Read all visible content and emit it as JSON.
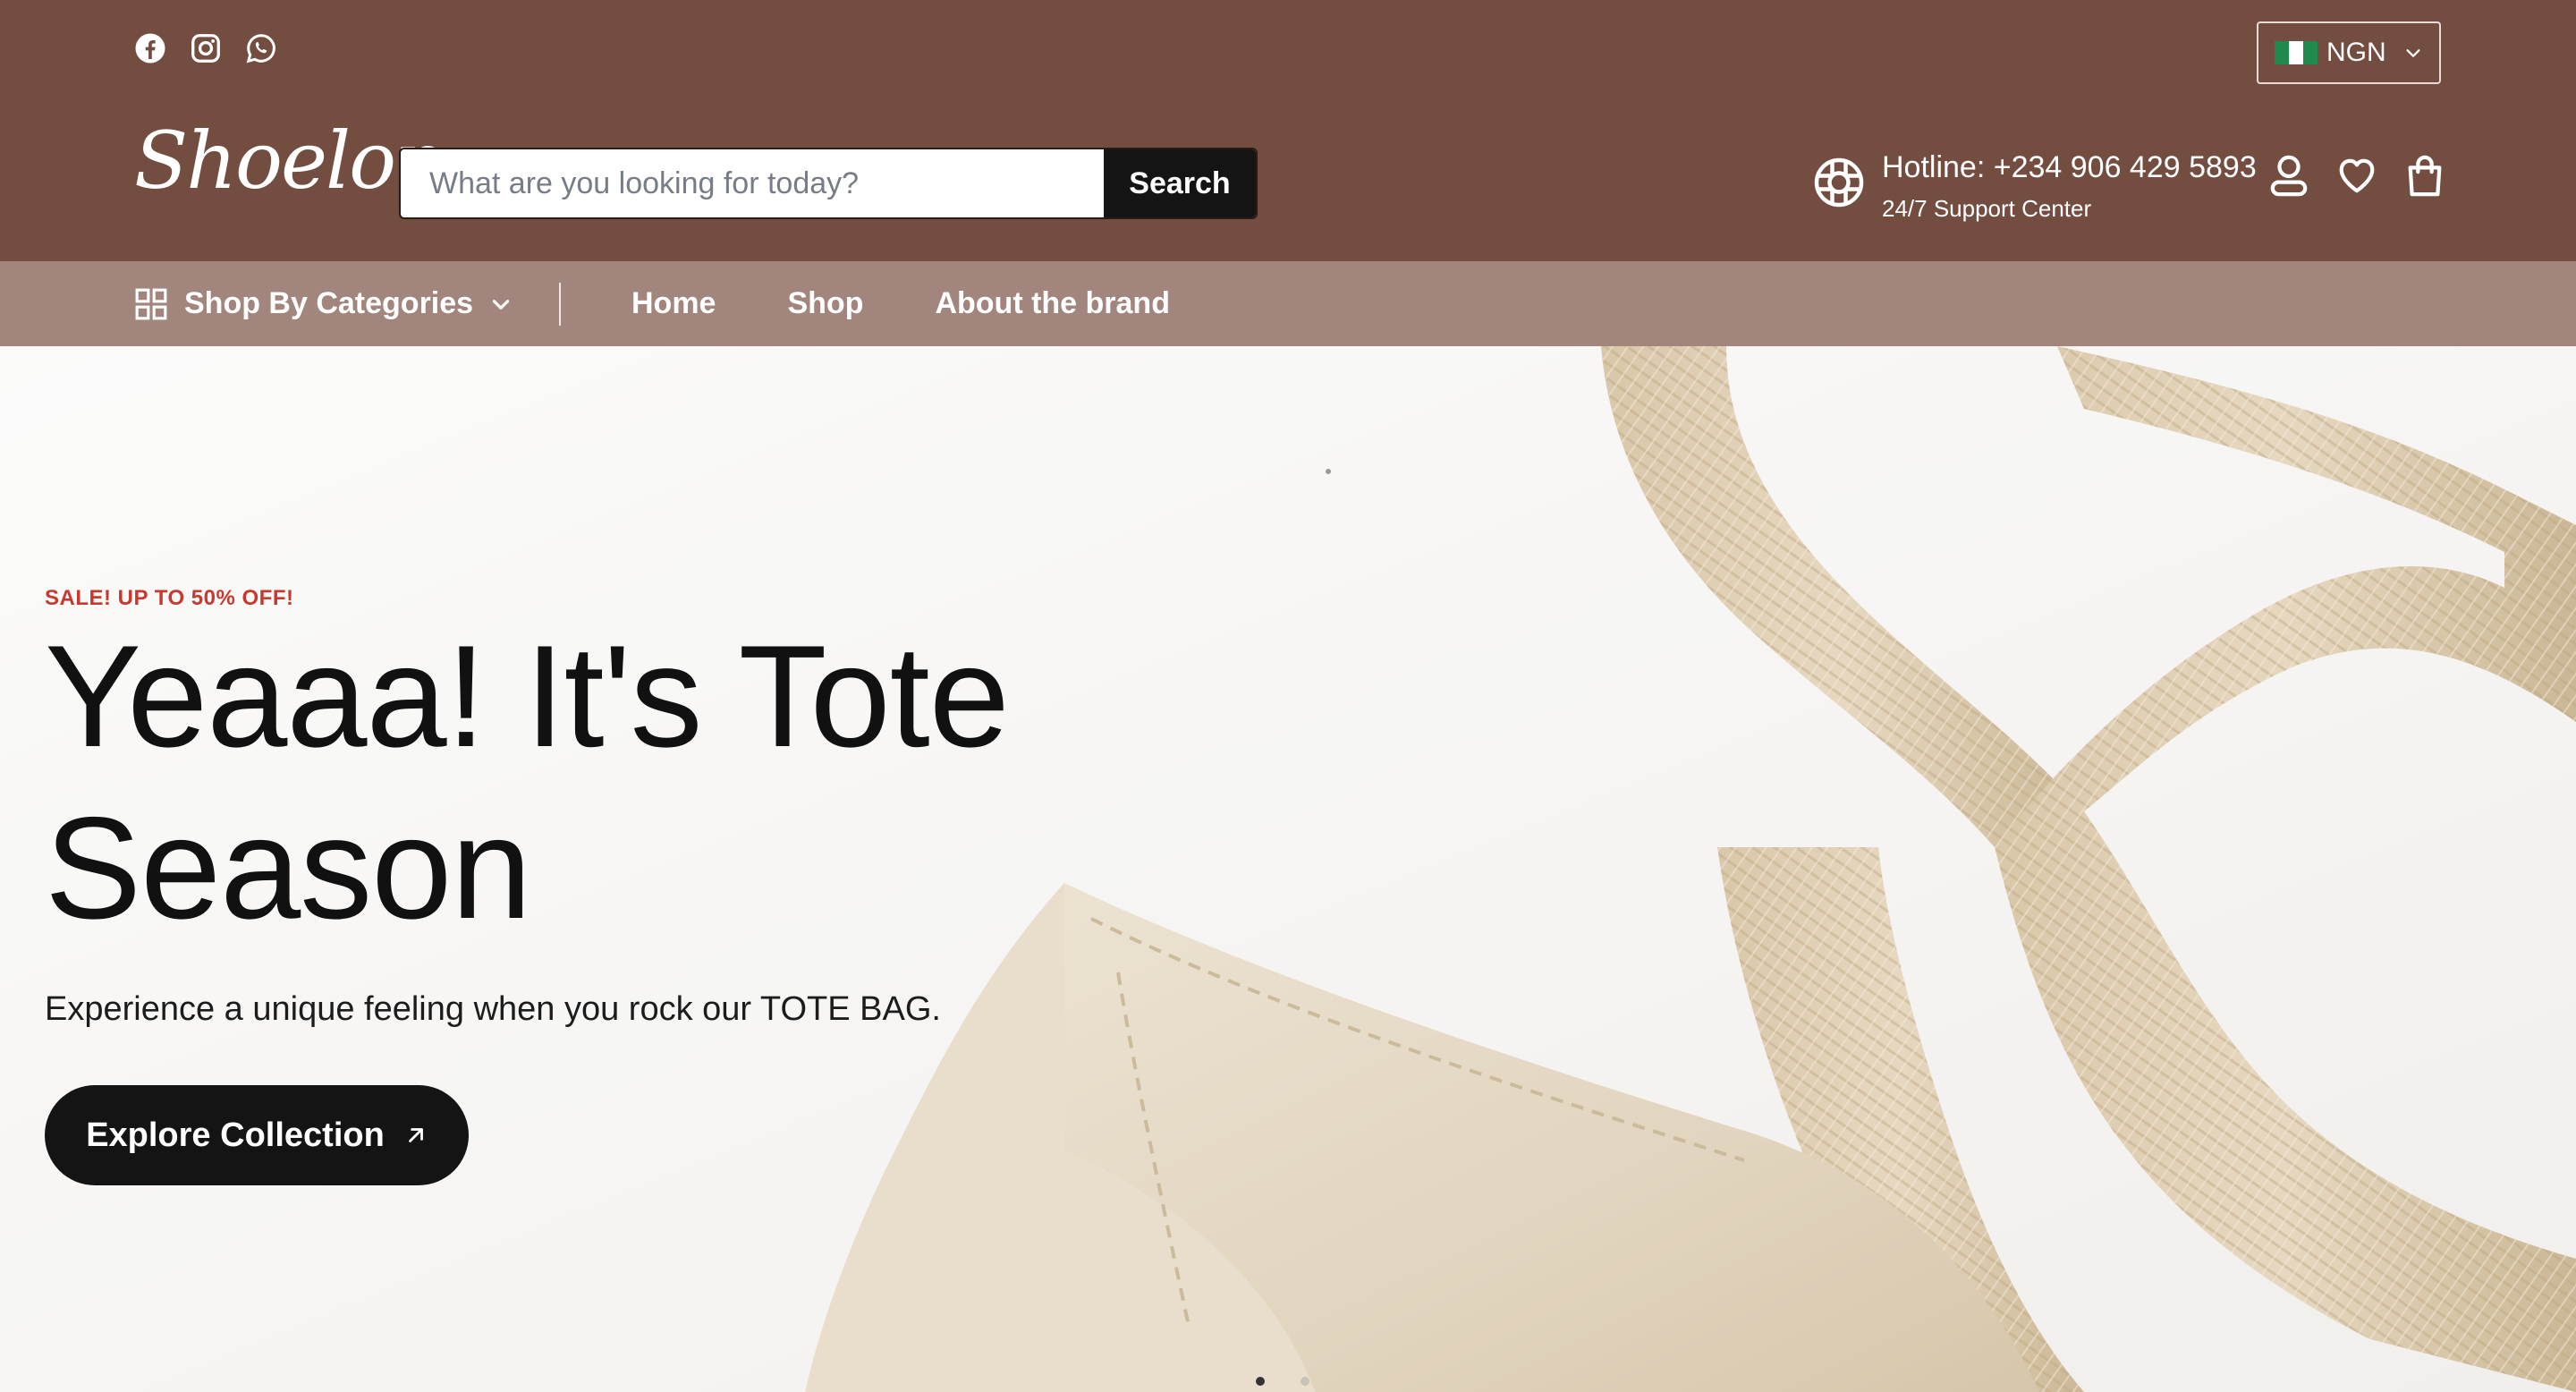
{
  "colors": {
    "header_bg": "#734d40",
    "nav_bg": "#a2857c",
    "sale_red": "#c7392f",
    "button_dark": "#141414"
  },
  "socials": [
    {
      "icon": "facebook-icon"
    },
    {
      "icon": "instagram-icon"
    },
    {
      "icon": "whatsapp-icon"
    }
  ],
  "currency": {
    "code": "NGN",
    "flag_icon": "nigeria-flag-icon"
  },
  "brand": {
    "logo_text": "Shoelon"
  },
  "search": {
    "placeholder": "What are you looking for today?",
    "value": "",
    "button_label": "Search"
  },
  "hotline": {
    "title": "Hotline: +234 906 429 5893",
    "subtitle": "24/7 Support Center",
    "icon": "lifebuoy-icon"
  },
  "header_icons": [
    "user-icon",
    "heart-icon",
    "shopping-bag-icon"
  ],
  "nav": {
    "categories_label": "Shop By Categories",
    "links": [
      "Home",
      "Shop",
      "About the brand"
    ]
  },
  "hero": {
    "sale_tag": "SALE! UP TO 50% OFF!",
    "title_line1": "Yeaaa! It's Tote",
    "title_line2": "Season",
    "subtitle": "Experience a unique feeling when you rock our TOTE BAG.",
    "cta_label": "Explore Collection",
    "image": "tote-bag-image",
    "slides_total": 2,
    "active_slide": 1
  }
}
